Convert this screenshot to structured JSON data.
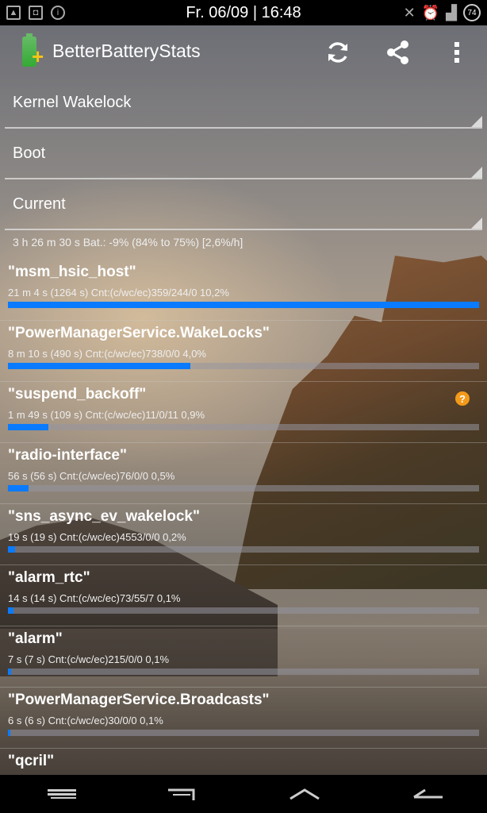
{
  "statusbar": {
    "datetime": "Fr. 06/09 | 16:48",
    "battery_level": "74",
    "left_icons": [
      "picture-icon",
      "robot-icon",
      "info-icon"
    ],
    "right_icons": [
      "mute-icon",
      "alarm-icon",
      "signal-icon",
      "battery-icon"
    ]
  },
  "actionbar": {
    "title": "BetterBatteryStats",
    "actions": [
      "refresh-icon",
      "share-icon",
      "overflow-menu-icon"
    ]
  },
  "spinners": {
    "stat_type": "Kernel Wakelock",
    "from": "Boot",
    "to": "Current"
  },
  "summary": "3 h 26 m 30 s  Bat.: -9% (84% to 75%) [2,6%/h]",
  "items": [
    {
      "name": "\"msm_hsic_host\"",
      "detail": "21 m 4 s  (1264 s) Cnt:(c/wc/ec)359/244/0 10,2%",
      "progress": 1.0
    },
    {
      "name": "\"PowerManagerService.WakeLocks\"",
      "detail": "8 m 10 s  (490 s) Cnt:(c/wc/ec)738/0/0 4,0%",
      "progress": 0.388
    },
    {
      "name": "\"suspend_backoff\"",
      "detail": "1 m 49 s  (109 s) Cnt:(c/wc/ec)11/0/11 0,9%",
      "progress": 0.086,
      "help": "?"
    },
    {
      "name": "\"radio-interface\"",
      "detail": "56 s  (56 s) Cnt:(c/wc/ec)76/0/0 0,5%",
      "progress": 0.044
    },
    {
      "name": "\"sns_async_ev_wakelock\"",
      "detail": "19 s  (19 s) Cnt:(c/wc/ec)4553/0/0 0,2%",
      "progress": 0.015
    },
    {
      "name": "\"alarm_rtc\"",
      "detail": "14 s  (14 s) Cnt:(c/wc/ec)73/55/7 0,1%",
      "progress": 0.011
    },
    {
      "name": "\"alarm\"",
      "detail": "7 s  (7 s) Cnt:(c/wc/ec)215/0/0 0,1%",
      "progress": 0.006
    },
    {
      "name": "\"PowerManagerService.Broadcasts\"",
      "detail": "6 s  (6 s) Cnt:(c/wc/ec)30/0/0 0,1%",
      "progress": 0.005
    },
    {
      "name": "\"qcril\"",
      "detail": "",
      "progress": 0
    }
  ],
  "navbar": [
    "menu-icon",
    "recents-icon",
    "home-icon",
    "back-icon"
  ],
  "colors": {
    "accent": "#0a7bff",
    "help": "#f39a1a"
  }
}
